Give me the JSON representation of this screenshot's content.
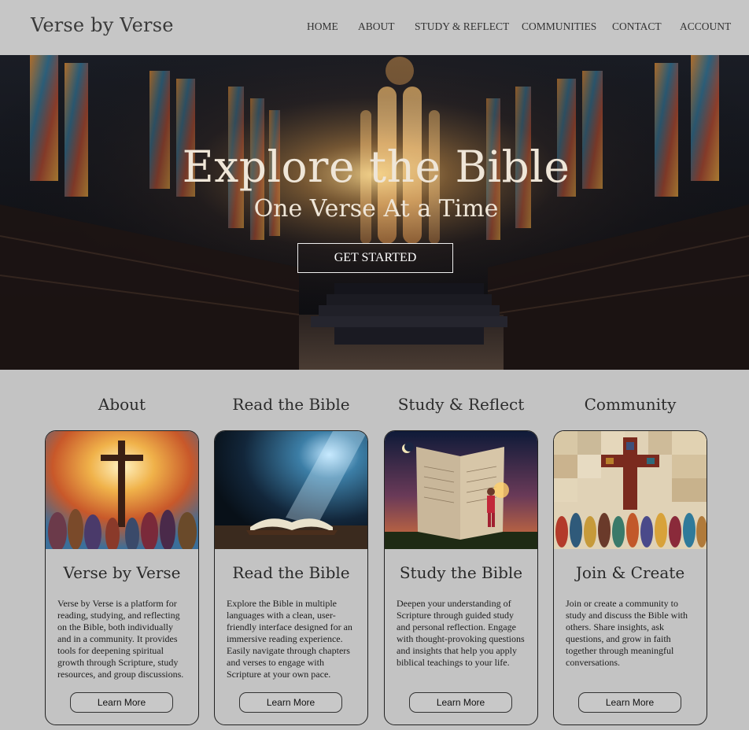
{
  "header": {
    "brand": "Verse by Verse",
    "nav": [
      "HOME",
      "ABOUT",
      "STUDY & REFLECT",
      "COMMUNITIES",
      "CONTACT",
      "ACCOUNT"
    ]
  },
  "hero": {
    "title": "Explore the Bible",
    "subtitle": "One Verse At a Time",
    "cta": "GET STARTED"
  },
  "sections": [
    {
      "heading": "About",
      "card_title": "Verse by Verse",
      "text": "Verse by Verse is a platform for reading, studying, and reflecting on the Bible, both individually and in a community. It provides tools for deepening spiritual growth through Scripture, study resources, and group discussions.",
      "button": "Learn More",
      "image": "cross-and-crowd-painting"
    },
    {
      "heading": "Read the Bible",
      "card_title": "Read the Bible",
      "text": "Explore the Bible in multiple languages with a clean, user-friendly interface designed for an immersive reading experience. Easily navigate through chapters and verses to engage with Scripture at your own pace.",
      "button": "Learn More",
      "image": "open-bible-in-light"
    },
    {
      "heading": "Study & Reflect",
      "card_title": "Study the Bible",
      "text": "Deepen your understanding of Scripture through guided study and personal reflection. Engage with thought-provoking questions and insights that help you apply biblical teachings to your life.",
      "button": "Learn More",
      "image": "child-reading-giant-book"
    },
    {
      "heading": "Community",
      "card_title": "Join & Create",
      "text": "Join or create a community to study and discuss the Bible with others. Share insights, ask questions, and grow in faith together through meaningful conversations.",
      "button": "Learn More",
      "image": "mosaic-cross-community"
    }
  ],
  "colors": {
    "page_bg": "#c3c3c3",
    "header_bg": "#c6c6c6",
    "hero_text": "#efe6d8"
  }
}
